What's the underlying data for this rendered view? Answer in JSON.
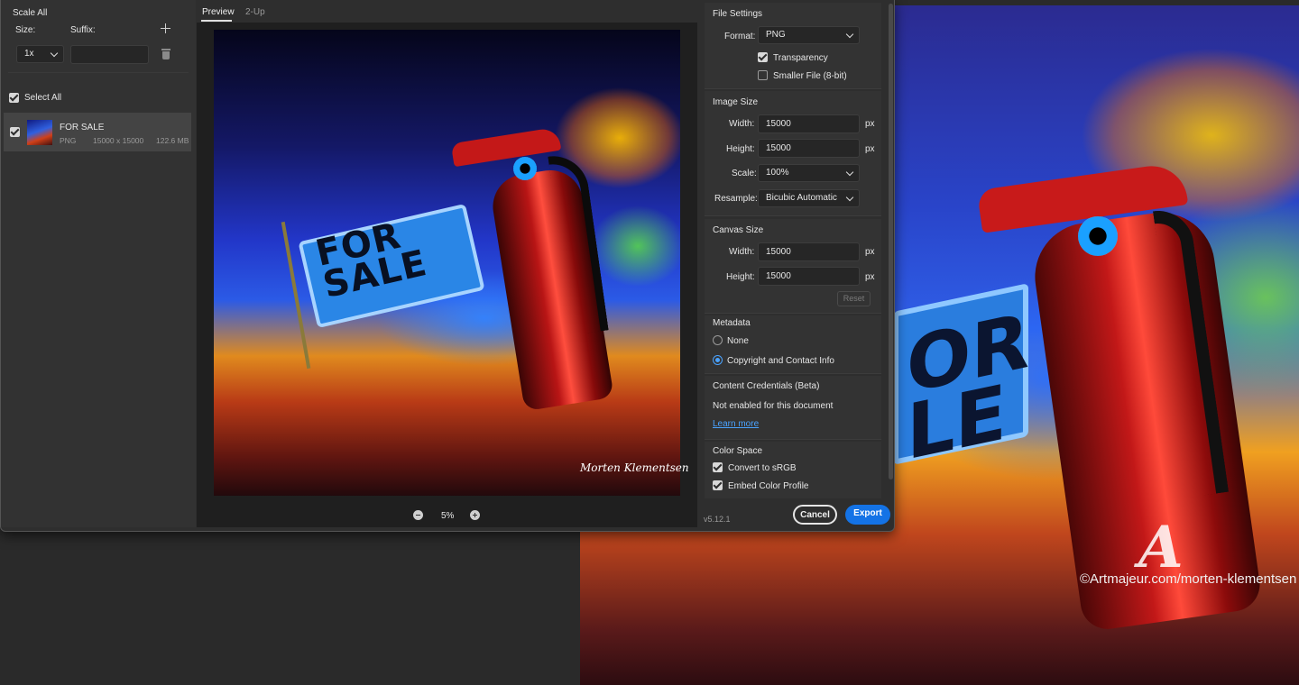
{
  "left": {
    "scale_all": "Scale All",
    "size_label": "Size:",
    "suffix_label": "Suffix:",
    "size_value": "1x",
    "suffix_value": "",
    "select_all": "Select All",
    "item": {
      "name": "FOR SALE",
      "format": "PNG",
      "dimensions": "15000 x 15000",
      "filesize": "122.6 MB"
    }
  },
  "tabs": [
    {
      "label": "Preview"
    },
    {
      "label": "2-Up"
    }
  ],
  "preview": {
    "zoom": "5%",
    "art_sign_text": "FOR SALE",
    "signature": "Morten Klementsen"
  },
  "file_settings": {
    "title": "File Settings",
    "format_label": "Format:",
    "format_value": "PNG",
    "transparency": "Transparency",
    "smaller_file": "Smaller File (8-bit)"
  },
  "image_size": {
    "title": "Image Size",
    "width_label": "Width:",
    "width_value": "15000",
    "width_unit": "px",
    "height_label": "Height:",
    "height_value": "15000",
    "height_unit": "px",
    "scale_label": "Scale:",
    "scale_value": "100%",
    "resample_label": "Resample:",
    "resample_value": "Bicubic Automatic"
  },
  "canvas_size": {
    "title": "Canvas Size",
    "width_label": "Width:",
    "width_value": "15000",
    "width_unit": "px",
    "height_label": "Height:",
    "height_value": "15000",
    "height_unit": "px",
    "reset": "Reset"
  },
  "metadata": {
    "title": "Metadata",
    "none": "None",
    "copyright": "Copyright and Contact Info"
  },
  "content_credentials": {
    "title": "Content Credentials (Beta)",
    "status": "Not enabled for this document",
    "link": "Learn more"
  },
  "color_space": {
    "title": "Color Space",
    "convert": "Convert to sRGB",
    "embed": "Embed Color Profile"
  },
  "footer": {
    "version": "v5.12.1",
    "cancel": "Cancel",
    "export": "Export"
  },
  "background": {
    "watermark": "©Artmajeur.com/morten-klementsen",
    "sign_text": "FOR\nSALE"
  },
  "colors": {
    "accent": "#1473e6",
    "link": "#4aa3ff"
  }
}
